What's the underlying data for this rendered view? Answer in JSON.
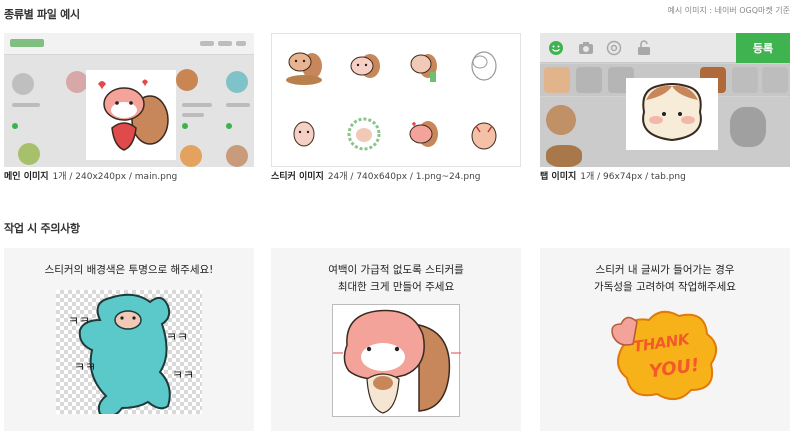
{
  "section1": {
    "title": "종류별 파일 예시",
    "source_note": "예시 이미지 : 네이버 OGQ마켓 기준",
    "cards": [
      {
        "label": "메인 이미지",
        "detail": "1개 / 240x240px / main.png"
      },
      {
        "label": "스티커 이미지",
        "detail": "24개 / 740x640px / 1.png~24.png"
      },
      {
        "label": "탭 이미지",
        "detail": "1개 / 96x74px / tab.png"
      }
    ],
    "tab_mock": {
      "register_button": "등록"
    }
  },
  "section2": {
    "title": "작업 시 주의사항",
    "notes": [
      {
        "line1": "스티커의 배경색은 투명으로 해주세요!",
        "line2": ""
      },
      {
        "line1": "여백이 가급적 없도록 스티커를",
        "line2": "최대한 크게 만들어 주세요"
      },
      {
        "line1": "스티커 내 글씨가 들어가는 경우",
        "line2": "가독성을 고려하여 작업해주세요"
      }
    ],
    "sample_text": {
      "thank": "THANK",
      "you": "YOU!"
    },
    "sound_text": "ㅋㅋ"
  },
  "colors": {
    "accent_green": "#3fb34f",
    "sticker_tan": "#c8875a",
    "sticker_pink": "#f3a39a",
    "sticker_teal": "#5bc9c9",
    "thanks_yellow": "#f7b21a"
  },
  "icons": [
    "smiley-icon",
    "camera-icon",
    "at-icon",
    "lock-icon"
  ]
}
